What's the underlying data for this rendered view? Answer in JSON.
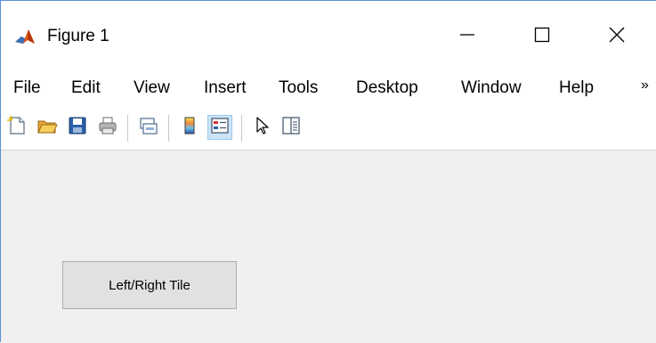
{
  "window": {
    "title": "Figure 1"
  },
  "menubar": {
    "items": [
      "File",
      "Edit",
      "View",
      "Insert",
      "Tools",
      "Desktop",
      "Window",
      "Help"
    ],
    "more_glyph": "»"
  },
  "toolbar": {
    "buttons": [
      {
        "icon": "new-figure-icon"
      },
      {
        "icon": "open-file-icon"
      },
      {
        "icon": "save-icon"
      },
      {
        "icon": "print-icon"
      },
      {
        "icon": "link-plot-icon"
      },
      {
        "icon": "insert-colorbar-icon"
      },
      {
        "icon": "insert-legend-icon",
        "active": true
      },
      {
        "icon": "edit-plot-icon"
      },
      {
        "icon": "open-property-inspector-icon"
      }
    ]
  },
  "figure": {
    "background": "#f0f0f0",
    "button_label": "Left/Right Tile"
  }
}
